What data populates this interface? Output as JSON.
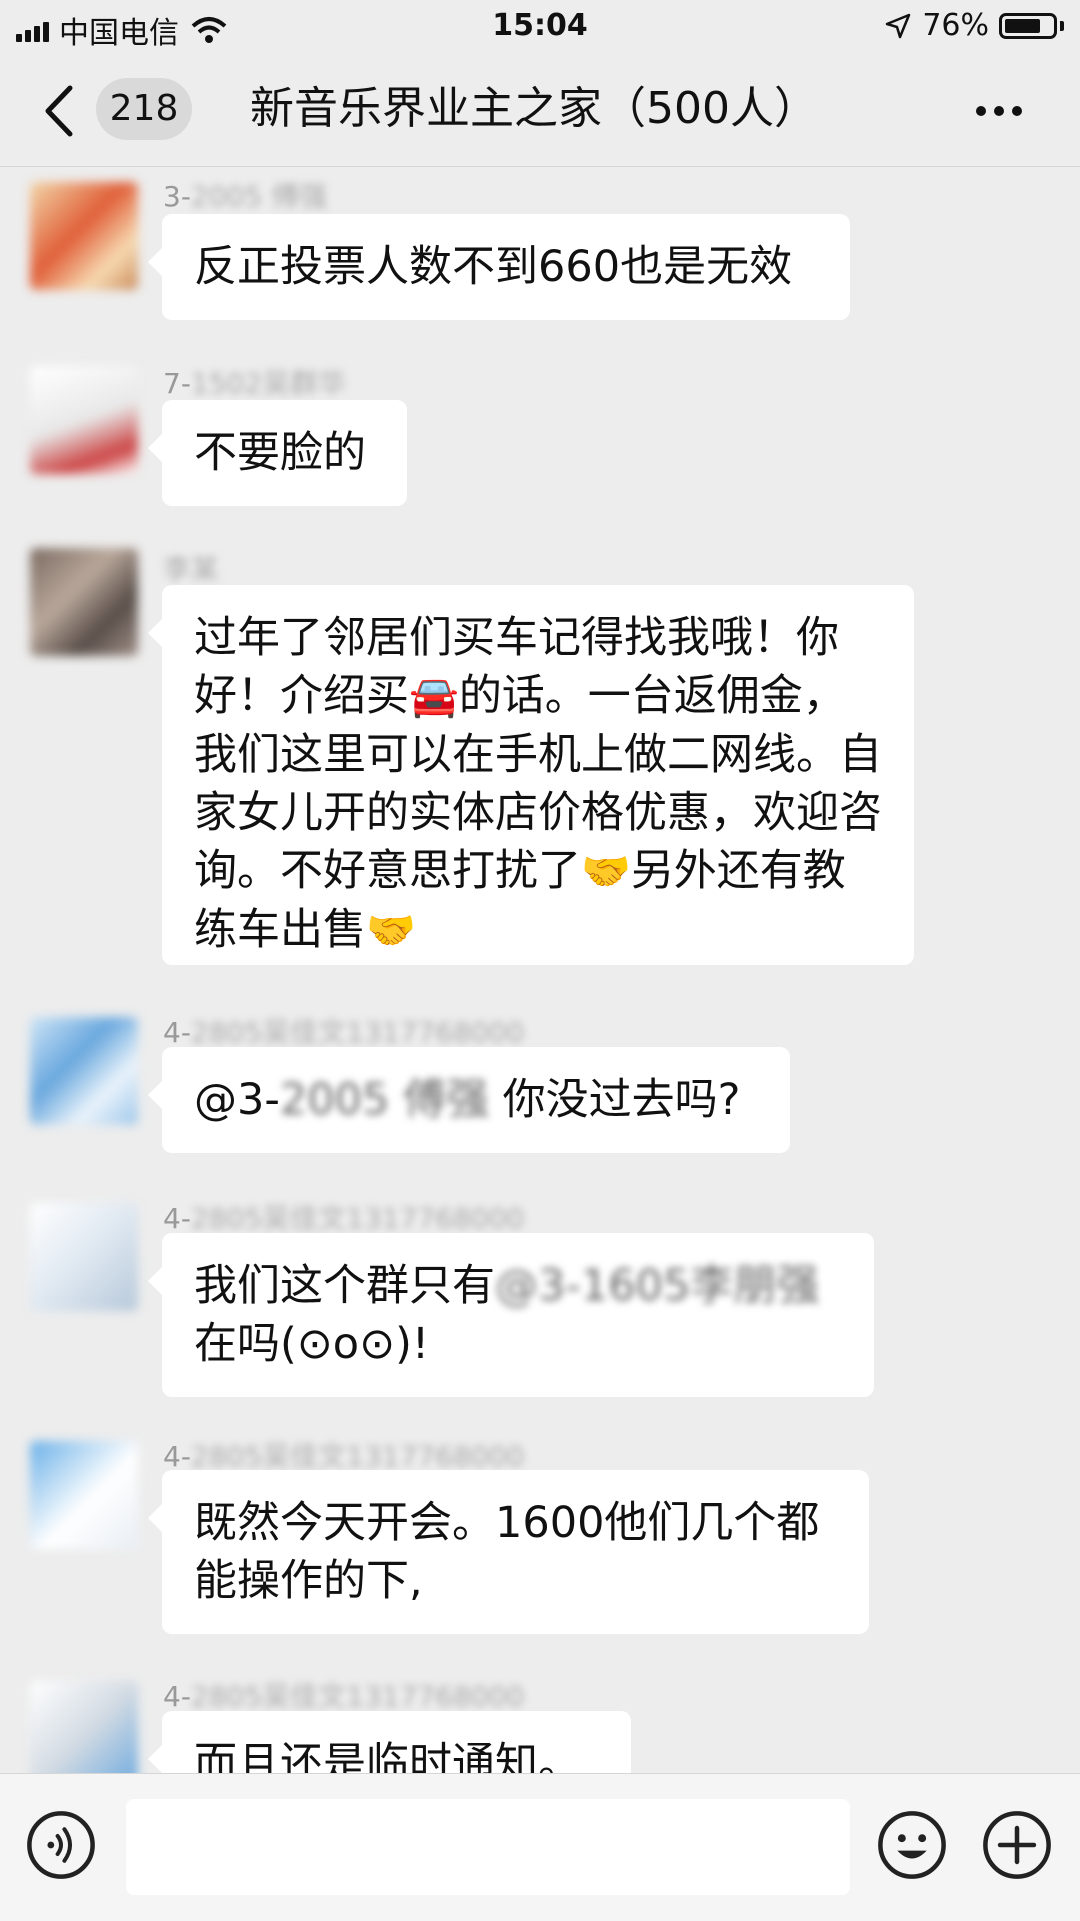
{
  "status_bar": {
    "carrier": "中国电信",
    "time": "15:04",
    "battery_percent": "76%",
    "battery_level": 0.76
  },
  "nav": {
    "unread_count": "218",
    "title": "新音乐界业主之家（500人）"
  },
  "messages": [
    {
      "sender_prefix": "3-",
      "sender_blurred": "2005 傅强",
      "text": "反正投票人数不到660也是无效"
    },
    {
      "sender_prefix": "7-",
      "sender_blurred": "1502吴群华",
      "text": "不要脸的"
    },
    {
      "sender_prefix": "",
      "sender_blurred": "李某",
      "text_part1": "过年了邻居们买车记得找我哦！你好！介绍买",
      "emoji_car": "🚘",
      "text_part2": "的话。一台返佣金，我们这里可以在手机上做二网线。自家女儿开的实体店价格优惠，欢迎咨询。不好意思打扰了",
      "emoji_handshake": "🤝",
      "text_part3": "另外还有教练车出售",
      "emoji_handshake2": "🤝"
    },
    {
      "sender_prefix": "4-",
      "sender_blurred": "2805吴佳文1317768000",
      "mention_prefix": "@3-",
      "mention_blurred": "2005 傅强",
      "text": " 你没过去吗?"
    },
    {
      "sender_prefix": "4-",
      "sender_blurred": "2805吴佳文1317768000",
      "text_part1": "我们这个群只有",
      "mention_blurred": "@3-1605李朋强",
      "text_part2": "在吗(⊙o⊙)!"
    },
    {
      "sender_prefix": "4-",
      "sender_blurred": "2805吴佳文1317768000",
      "text": "既然今天开会。1600他们几个都能操作的下,"
    },
    {
      "sender_prefix": "4-",
      "sender_blurred": "2805吴佳文1317768000",
      "text": "而且还是临时通知。"
    }
  ],
  "input": {
    "placeholder": ""
  },
  "colors": {
    "background": "#ededed",
    "bubble": "#ffffff",
    "sender": "#999999"
  },
  "icons": [
    "signal-icon",
    "wifi-icon",
    "location-arrow-icon",
    "battery-icon",
    "chevron-left-icon",
    "more-icon",
    "voice-icon",
    "emoji-icon",
    "plus-icon"
  ]
}
